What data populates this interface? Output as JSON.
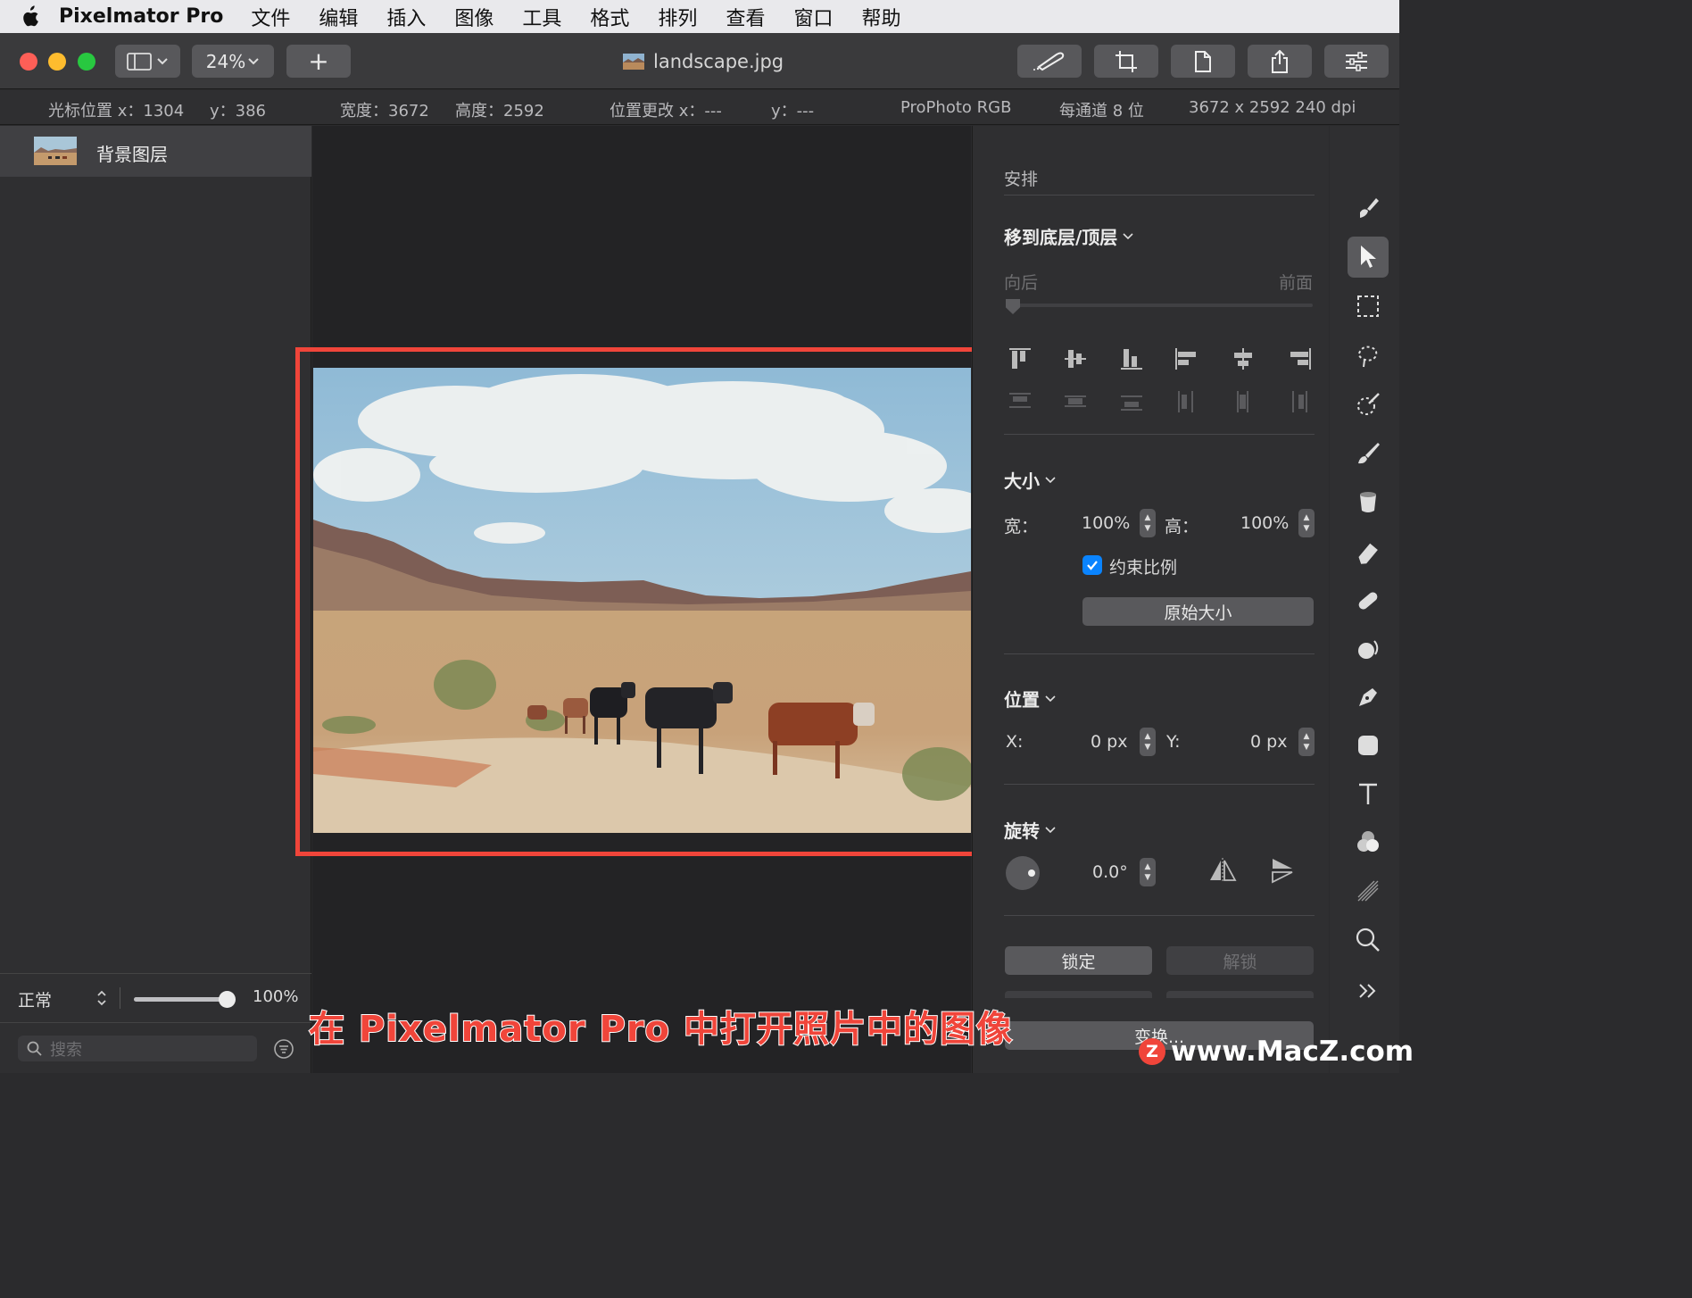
{
  "menubar": {
    "app_name": "Pixelmator Pro",
    "items": [
      "文件",
      "编辑",
      "插入",
      "图像",
      "工具",
      "格式",
      "排列",
      "查看",
      "窗口",
      "帮助"
    ]
  },
  "toolbar": {
    "zoom": "24%",
    "add_label": "+",
    "document_title": "landscape.jpg"
  },
  "infobar": {
    "cursor_x": "光标位置 x：1304",
    "cursor_y": "y：386",
    "width": "宽度：3672",
    "height": "高度：2592",
    "pos_change_x": "位置更改 x：---",
    "pos_change_y": "y：---",
    "color_profile": "ProPhoto RGB",
    "bit_depth": "每通道 8 位",
    "dimensions_dpi": "3672 x 2592 240 dpi"
  },
  "layers": {
    "items": [
      {
        "name": "背景图层"
      }
    ],
    "blend_mode": "正常",
    "opacity": "100%",
    "opacity_value": 1.0,
    "search_placeholder": "搜索"
  },
  "arrange": {
    "title": "安排",
    "move_section": "移到底层/顶层",
    "slider_left": "向后",
    "slider_right": "前面",
    "size_section": "大小",
    "width_label": "宽：",
    "width_value": "100%",
    "height_label": "高：",
    "height_value": "100%",
    "constrain_label": "约束比例",
    "constrain_checked": true,
    "original_size_button": "原始大小",
    "position_section": "位置",
    "x_label": "X:",
    "x_value": "0 px",
    "y_label": "Y:",
    "y_value": "0 px",
    "rotate_section": "旋转",
    "rotate_value": "0.0°",
    "lock_button": "锁定",
    "unlock_button": "解锁",
    "transform_button": "变换..."
  },
  "overlay": {
    "caption": "在 Pixelmator Pro 中打开照片中的图像",
    "watermark": "www.MacZ.com",
    "watermark_badge": "Z"
  },
  "colors": {
    "highlight_frame": "#f0453a",
    "close": "#fe5f57",
    "minimize": "#febc2e",
    "zoom": "#28c840",
    "accent": "#0a84ff"
  }
}
